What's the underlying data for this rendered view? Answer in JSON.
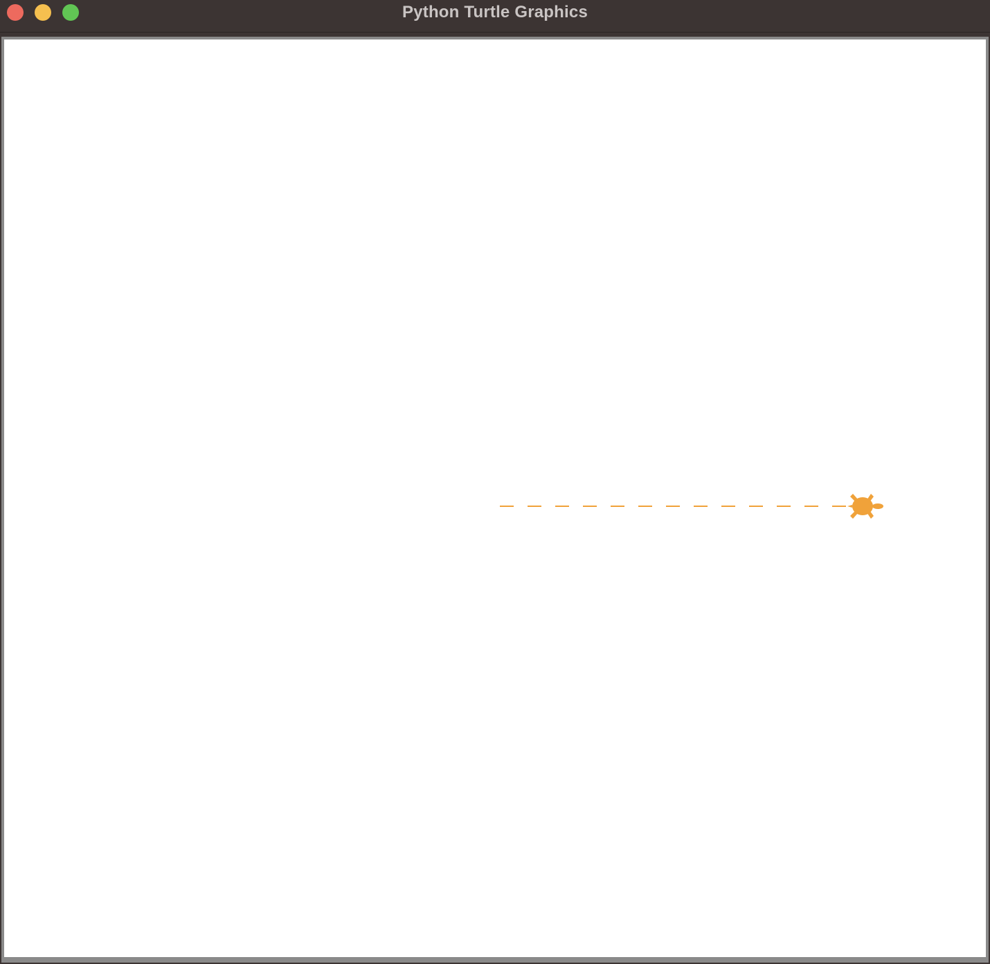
{
  "window": {
    "title": "Python Turtle Graphics",
    "controls": {
      "close_color": "#ed6a5e",
      "minimize_color": "#f5bf4f",
      "maximize_color": "#61c554"
    }
  },
  "canvas": {
    "background": "#ffffff",
    "pen_color": "#f0a23a",
    "turtle_color": "#f0a23a",
    "line_style": "dashed",
    "turtle_shape": "turtle-icon",
    "turtle_heading": "east"
  }
}
